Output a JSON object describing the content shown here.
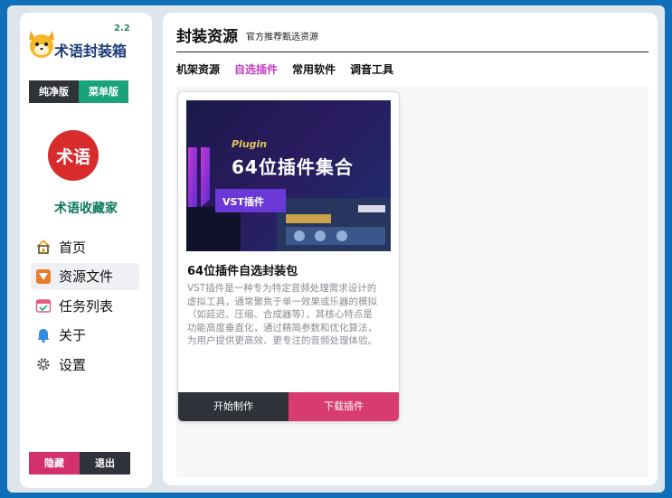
{
  "sidebar": {
    "version": "2.2",
    "app_name": "术语封装箱",
    "editions": [
      "纯净版",
      "菜单版"
    ],
    "brand_logo_text": "术语",
    "brand_name": "术语收藏家",
    "nav": [
      {
        "label": "首页",
        "icon": "home-icon"
      },
      {
        "label": "资源文件",
        "icon": "resource-icon"
      },
      {
        "label": "任务列表",
        "icon": "calendar-check-icon"
      },
      {
        "label": "关于",
        "icon": "bell-icon"
      },
      {
        "label": "设置",
        "icon": "gear-icon"
      }
    ],
    "active_nav": "资源文件",
    "hide_label": "隐藏",
    "exit_label": "退出"
  },
  "main": {
    "title": "封装资源",
    "subtitle": "官方推荐甄选资源",
    "tabs": [
      "机架资源",
      "自选插件",
      "常用软件",
      "调音工具"
    ],
    "active_tab": "自选插件",
    "card": {
      "banner_tag": "Plugin",
      "banner_heading": "64位插件集合",
      "banner_badge": "VST插件",
      "title": "64位插件自选封装包",
      "description": "VST插件是一种专为特定音频处理需求设计的虚拟工具，通常聚焦于单一效果或乐器的模拟（如延迟、压缩、合成器等）。其核心特点是功能高度垂直化，通过精简参数和优化算法，为用户提供更高效、更专注的音频处理体验。",
      "start_label": "开始制作",
      "download_label": "下载插件"
    }
  },
  "colors": {
    "accent_green": "#1aa37a",
    "accent_pink": "#d83b6f",
    "dark": "#2f3238",
    "tab_active": "#c13fbf"
  }
}
